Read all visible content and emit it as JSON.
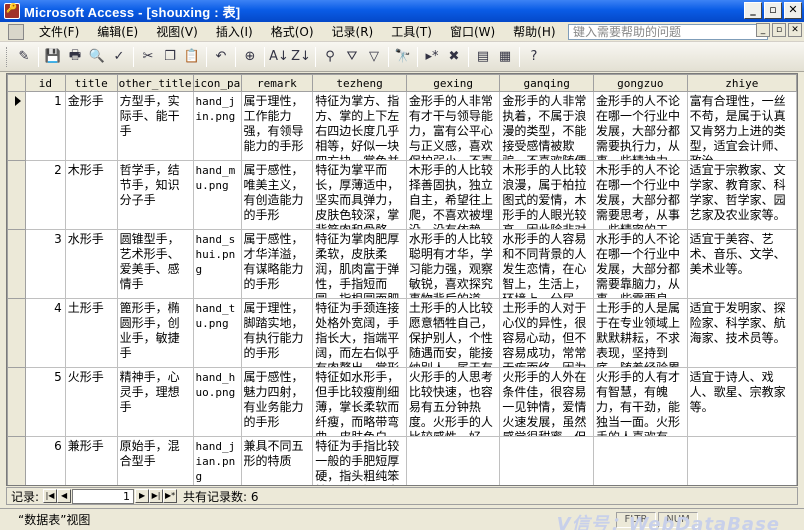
{
  "window": {
    "title": "Microsoft Access - [shouxing : 表]"
  },
  "menu": {
    "items": [
      "文件(F)",
      "编辑(E)",
      "视图(V)",
      "插入(I)",
      "格式(O)",
      "记录(R)",
      "工具(T)",
      "窗口(W)",
      "帮助(H)"
    ],
    "help_placeholder": "键入需要帮助的问题"
  },
  "toolbar": {
    "icons": [
      "view-icon",
      "save-icon",
      "print-icon",
      "print-preview-icon",
      "spelling-icon",
      "cut-icon",
      "copy-icon",
      "paste-icon",
      "undo-icon",
      "hyperlink-icon",
      "sort-ascending-icon",
      "sort-descending-icon",
      "filter-by-selection-icon",
      "filter-by-form-icon",
      "apply-filter-icon",
      "find-icon",
      "new-record-icon",
      "delete-record-icon",
      "database-window-icon",
      "new-object-icon",
      "help-icon"
    ]
  },
  "table": {
    "columns": [
      "id",
      "title",
      "other_title",
      "icon_pa",
      "remark",
      "tezheng",
      "gexing",
      "ganqing",
      "gongzuo",
      "zhiye"
    ],
    "rows": [
      {
        "id": "1",
        "title": "金形手",
        "other_title": "方型手，实际手、能干手",
        "icon": "hand_jin.png",
        "remark": "属于理性，工作能力强，有领导能力的手形",
        "tezheng": "特征为掌方、指方、掌的上下左右四边长度几乎相等，好似一块四方块，掌色并",
        "gexing": "金形手的人非常有才干与领导能力，富有公平心与正义感，喜欢保护弱小，不喜",
        "ganqing": "金形手的人非常执着，不属于浪漫的类型，不能接受感情被欺骗，不喜欢随便",
        "gongzuo": "金形手的人不论在哪一个行业中发展，大部分都需要执行力，从事一些精神力",
        "zhiye": "富有合理性，一丝不苟，是属于认真又肯努力上进的类型，适宜会计师、政治"
      },
      {
        "id": "2",
        "title": "木形手",
        "other_title": "哲学手，结节手，知识分子手",
        "icon": "hand_mu.png",
        "remark": "属于感性，唯美主义，有创造能力的手形",
        "tezheng": "特征为掌平而长，厚薄适中，坚实而具弹力，皮肤色较深，掌背筋肉和骨骼",
        "gexing": "木形手的人比较择善固执，独立自主，希望往上爬，不喜欢被埋没，没有依赖",
        "ganqing": "木形手的人比较浪漫，属于柏拉图式的爱情，木形手的人眼光较高，因此除非对",
        "gongzuo": "木形手的人不论在哪一个行业中发展，大部分都需要思考，从事一些精密的工",
        "zhiye": "适宜于宗教家、文学家、教育家、科学家、哲学家、园艺家及农业家等。"
      },
      {
        "id": "3",
        "title": "水形手",
        "other_title": "圆锥型手，艺术形手、爱美手、感情手",
        "icon": "hand_shui.png",
        "remark": "属于感性，才华洋溢，有谋略能力的手形",
        "tezheng": "特征为掌肉肥厚柔软，皮肤柔润，肌肉富于弹性，手指短而圆，指根圆而肥厚",
        "gexing": "水形手的人比较聪明有才华，学习能力强，观察敏锐，喜欢探究事物背后的道",
        "ganqing": "水形手的人容易和不同背景的人发生恋情，在心智上，生活上，环境上，分居",
        "gongzuo": "水形手的人不论在哪一个行业中发展，大部分都需要靠脑力，从事一些需要良",
        "zhiye": "适宜于美容、艺术、音乐、文学、美术业等。"
      },
      {
        "id": "4",
        "title": "土形手",
        "other_title": "篦形手，椭圆形手，创业手，敏捷手",
        "icon": "hand_tu.png",
        "remark": "属于理性，脚踏实地，有执行能力的手形",
        "tezheng": "特征为手颈连接处格外宽阔，手指长大，指端平阔，而左右似乎有肉赘出，掌形",
        "gexing": "土形手的人比较愿意牺牲自己，保护别人，个性随遇而安，能接纳别人，属于有",
        "ganqing": "土形手的人对于心仪的异性，很容易心动，但不容易成功，常常无疾而终，因为",
        "gongzuo": "土形手的人是属于在专业领域上默默耕耘，不求表现，坚持到底，随着经验累",
        "zhiye": "适宜于发明家、探险家、科学家、航海家、技术员等。"
      },
      {
        "id": "5",
        "title": "火形手",
        "other_title": "精神手，心灵手，理想手",
        "icon": "hand_huo.png",
        "remark": "属于感性，魅力四射，有业务能力的手形",
        "tezheng": "特征如水形手，但手比较瘦削细薄，掌长柔软而纤瘦，而略带弯曲，皮肤色白，",
        "gexing": "火形手的人思考比较快速，也容易有五分钟热度。火形手的人比较感性，好",
        "ganqing": "火形手的人外在条件佳，很容易一见钟情，爱情火速发展，虽然感觉很甜蜜，但",
        "gongzuo": "火形手的人有才有智慧，有魄力，有干劲，能独当一面。火形手的人喜欢有",
        "zhiye": "适宜于诗人、戏人、歌星、宗教家等。"
      },
      {
        "id": "6",
        "title": "兼形手",
        "other_title": "原始手，混合型手",
        "icon": "hand_jian.png",
        "remark": "兼具不同五形的特质",
        "tezheng": "特征为手指比较一般的手肥短厚硬，指头粗纯笨拙，手形短而弯",
        "gexing": "",
        "ganqing": "",
        "gongzuo": "",
        "zhiye": ""
      }
    ]
  },
  "navigator": {
    "label": "记录:",
    "current": "1",
    "count_text": "共有记录数: 6"
  },
  "status": {
    "view_text": "“数据表”视图",
    "cells": [
      "FLTR",
      "NUM"
    ],
    "watermark": "V信号：WebDataBase"
  }
}
